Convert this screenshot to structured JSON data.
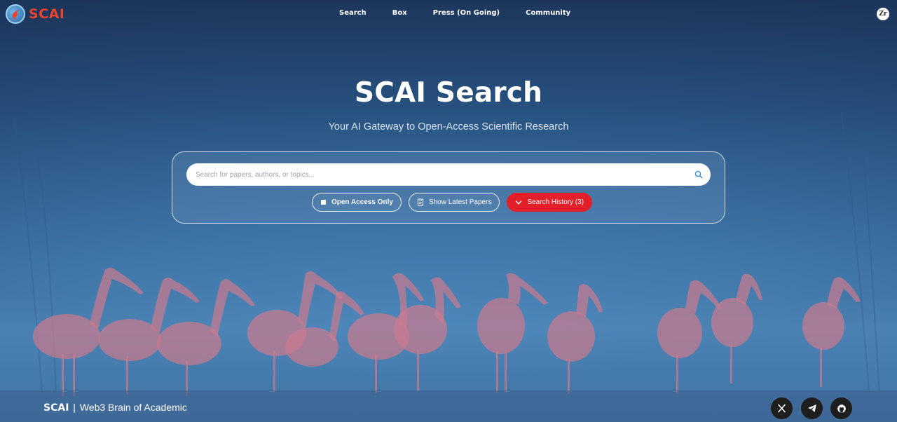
{
  "brand": {
    "name": "SCAI",
    "accent": "#e8432e"
  },
  "nav": {
    "items": [
      {
        "label": "Search"
      },
      {
        "label": "Box"
      },
      {
        "label": "Press (On Going)"
      },
      {
        "label": "Community"
      }
    ]
  },
  "user": {
    "avatar_initials": "Zr"
  },
  "hero": {
    "title": "SCAI Search",
    "subtitle": "Your AI Gateway to Open-Access Scientific Research"
  },
  "search": {
    "placeholder": "Search for papers, authors, or topics...",
    "value": "",
    "icon": "search-icon"
  },
  "filters": {
    "open_access_label": "Open Access Only",
    "latest_papers_label": "Show Latest Papers",
    "history_label": "Search History (3)",
    "history_color": "#e3202a"
  },
  "footer": {
    "brand": "SCAI",
    "tagline": "Web3 Brain of Academic",
    "separator": "|",
    "social": [
      {
        "icon": "x-icon"
      },
      {
        "icon": "telegram-icon"
      },
      {
        "icon": "github-icon"
      }
    ]
  }
}
